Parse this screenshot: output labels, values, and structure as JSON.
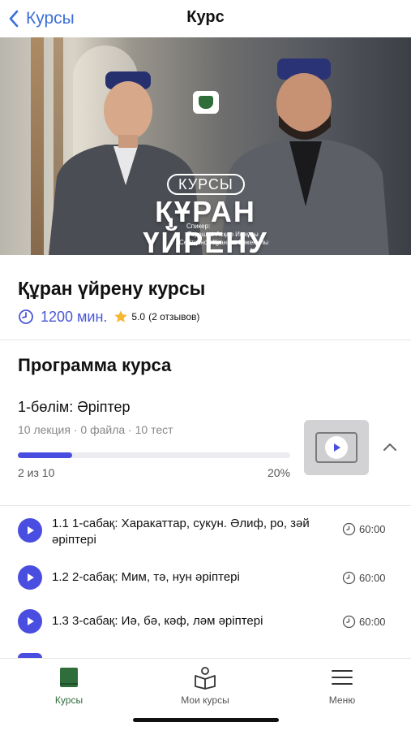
{
  "navbar": {
    "back_label": "Курсы",
    "title": "Курс"
  },
  "hero": {
    "badge": "КУРСЫ",
    "title_line1": "ҚҰРАН",
    "title_line2": "ҮЙРЕНУ",
    "speaker_label": "Спикер:",
    "speaker1": "Торешов Асқар Исаұлы",
    "speaker2": "Сейтқанов Қуаныш Бәкенұлы"
  },
  "course": {
    "title": "Құран үйрену курсы",
    "duration": "1200 мин.",
    "rating": "5.0",
    "reviews": "(2 отзывов)"
  },
  "program": {
    "title": "Программа курса",
    "section": {
      "title": "1-бөлім: Әріптер",
      "meta": "10 лекция · 0 файла · 10 тест",
      "progress_fraction": 0.2,
      "progress_count": "2 из 10",
      "progress_pct": "20%"
    },
    "lessons": [
      {
        "title": "1.1 1-сабақ: Харакаттар, сукун. Әлиф, ро, зәй әріптері",
        "duration": "60:00"
      },
      {
        "title": "1.2 2-сабақ: Мим, тә, нун әріптері",
        "duration": "60:00"
      },
      {
        "title": "1.3 3-сабақ: Иә, бә, кәф, ләм әріптері",
        "duration": "60:00"
      }
    ]
  },
  "tabbar": {
    "tabs": [
      {
        "label": "Курсы",
        "icon": "book-icon",
        "active": true
      },
      {
        "label": "Мои курсы",
        "icon": "open-book-person-icon",
        "active": false
      },
      {
        "label": "Меню",
        "icon": "menu-icon",
        "active": false
      }
    ]
  },
  "colors": {
    "accent": "#4a4ee0",
    "link_blue": "#3d6fd8",
    "tab_active": "#2f6d3b",
    "tab_inactive": "#555555"
  }
}
